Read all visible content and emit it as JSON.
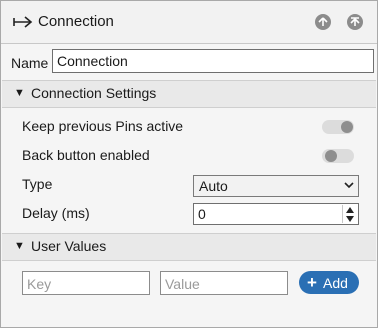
{
  "panel": {
    "title": "Connection",
    "icons": {
      "header": "connection-arrow-icon",
      "up1": "arrow-up-circle-icon",
      "up2": "arrow-up-circle-icon"
    }
  },
  "name_field": {
    "label": "Name",
    "value": "Connection"
  },
  "connection_settings": {
    "header": "Connection Settings",
    "keep_pins": {
      "label": "Keep previous Pins active",
      "enabled": false
    },
    "back_button": {
      "label": "Back button enabled",
      "enabled": false
    },
    "type": {
      "label": "Type",
      "selected": "Auto"
    },
    "delay": {
      "label": "Delay (ms)",
      "value": "0"
    }
  },
  "user_values": {
    "header": "User Values",
    "key_placeholder": "Key",
    "value_placeholder": "Value",
    "add_label": "Add"
  },
  "colors": {
    "accent": "#2a6fb4",
    "toggle_off": "#dcdcdc",
    "knob": "#8e8e8e"
  }
}
